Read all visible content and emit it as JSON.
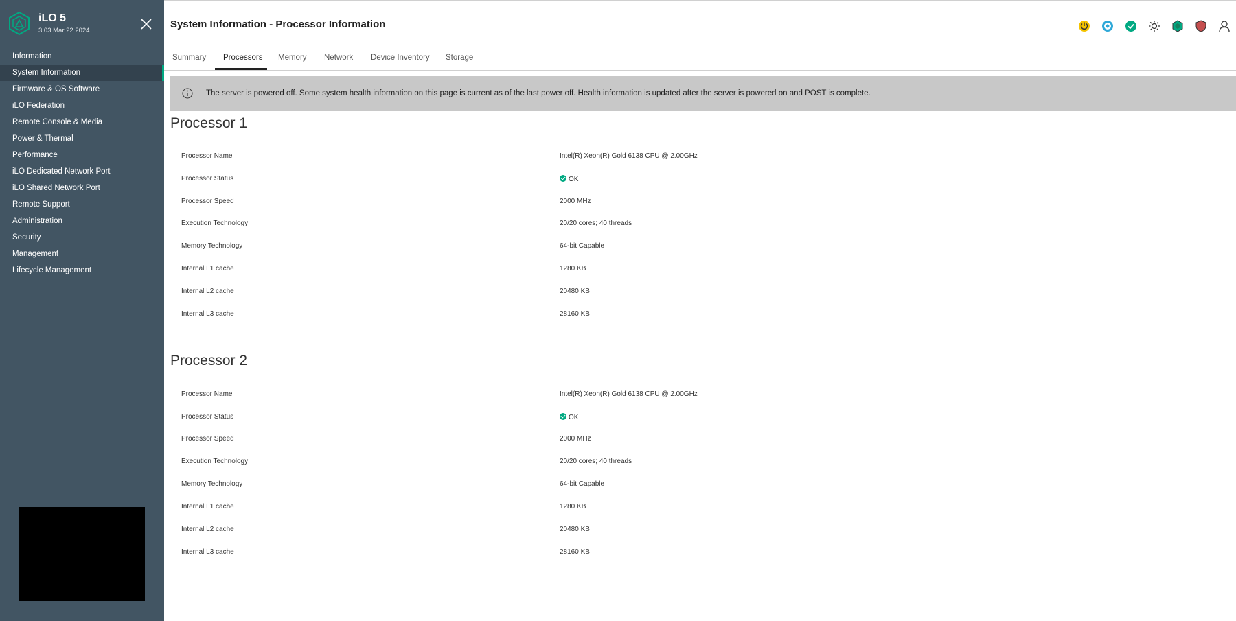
{
  "app": {
    "name": "iLO 5",
    "version": "3.03 Mar 22 2024"
  },
  "sidebar": {
    "items": [
      {
        "label": "Information"
      },
      {
        "label": "System Information"
      },
      {
        "label": "Firmware & OS Software"
      },
      {
        "label": "iLO Federation"
      },
      {
        "label": "Remote Console & Media"
      },
      {
        "label": "Power & Thermal"
      },
      {
        "label": "Performance"
      },
      {
        "label": "iLO Dedicated Network Port"
      },
      {
        "label": "iLO Shared Network Port"
      },
      {
        "label": "Remote Support"
      },
      {
        "label": "Administration"
      },
      {
        "label": "Security"
      },
      {
        "label": "Management"
      },
      {
        "label": "Lifecycle Management"
      }
    ],
    "active": "System Information"
  },
  "header": {
    "title": "System Information - Processor Information",
    "icons": [
      "power-icon",
      "uid-icon",
      "health-ok-icon",
      "sun-icon",
      "hexagon-icon",
      "shield-icon",
      "user-icon"
    ]
  },
  "tabs": [
    {
      "label": "Summary"
    },
    {
      "label": "Processors"
    },
    {
      "label": "Memory"
    },
    {
      "label": "Network"
    },
    {
      "label": "Device Inventory"
    },
    {
      "label": "Storage"
    }
  ],
  "active_tab": "Processors",
  "banner": {
    "text": "The server is powered off. Some system health information on this page is current as of the last power off. Health information is updated after the server is powered on and POST is complete."
  },
  "processors": [
    {
      "title": "Processor 1",
      "rows": [
        {
          "label": "Processor Name",
          "value": "Intel(R) Xeon(R) Gold 6138 CPU @ 2.00GHz"
        },
        {
          "label": "Processor Status",
          "value": "OK"
        },
        {
          "label": "Processor Speed",
          "value": "2000 MHz"
        },
        {
          "label": "Execution Technology",
          "value": "20/20 cores; 40 threads"
        },
        {
          "label": "Memory Technology",
          "value": "64-bit Capable"
        },
        {
          "label": "Internal L1 cache",
          "value": "1280 KB"
        },
        {
          "label": "Internal L2 cache",
          "value": "20480 KB"
        },
        {
          "label": "Internal L3 cache",
          "value": "28160 KB"
        }
      ]
    },
    {
      "title": "Processor 2",
      "rows": [
        {
          "label": "Processor Name",
          "value": "Intel(R) Xeon(R) Gold 6138 CPU @ 2.00GHz"
        },
        {
          "label": "Processor Status",
          "value": "OK"
        },
        {
          "label": "Processor Speed",
          "value": "2000 MHz"
        },
        {
          "label": "Execution Technology",
          "value": "20/20 cores; 40 threads"
        },
        {
          "label": "Memory Technology",
          "value": "64-bit Capable"
        },
        {
          "label": "Internal L1 cache",
          "value": "1280 KB"
        },
        {
          "label": "Internal L2 cache",
          "value": "20480 KB"
        },
        {
          "label": "Internal L3 cache",
          "value": "28160 KB"
        }
      ]
    }
  ],
  "colors": {
    "sidebar_bg": "#425563",
    "accent": "#01a982",
    "banner_bg": "#c8c8c8"
  }
}
